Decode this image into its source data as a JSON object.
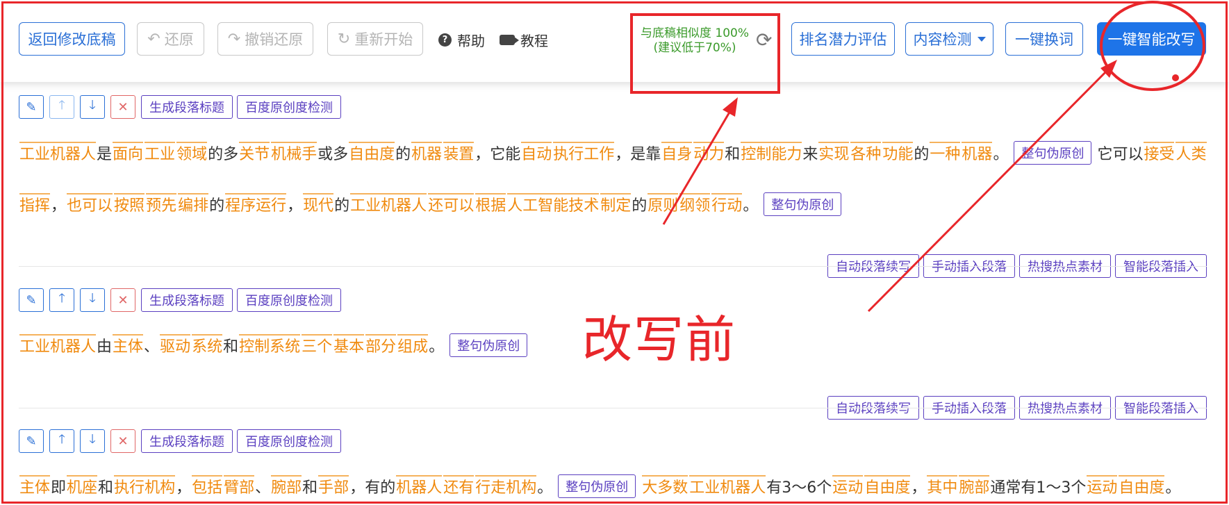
{
  "toolbar": {
    "back_label": "返回修改底稿",
    "undo_label": "还原",
    "redo_label": "撤销还原",
    "restart_label": "重新开始",
    "help_label": "帮助",
    "tutorial_label": "教程",
    "similarity_line1": "与底稿相似度 100%",
    "similarity_line2": "(建议低于70%)",
    "rank_label": "排名潜力评估",
    "content_check_label": "内容检测",
    "swap_words_label": "一键换词",
    "smart_rewrite_label": "一键智能改写"
  },
  "paragraph_controls": {
    "gen_title_label": "生成段落标题",
    "baidu_check_label": "百度原创度检测",
    "delete_symbol": "✕"
  },
  "rewrite_sentence_label": "整句伪原创",
  "actions": {
    "auto_continue": "自动段落续写",
    "manual_insert": "手动插入段落",
    "hot_material": "热搜热点素材",
    "smart_insert": "智能段落插入"
  },
  "paragraphs": [
    {
      "line1": [
        {
          "t": "工业机器人",
          "k": 1
        },
        {
          "t": "是",
          "k": 0
        },
        {
          "t": "面向",
          "k": 1
        },
        {
          "t": "工业",
          "k": 1
        },
        {
          "t": "领域",
          "k": 1
        },
        {
          "t": "的多",
          "k": 0
        },
        {
          "t": "关节",
          "k": 1
        },
        {
          "t": "机械手",
          "k": 1
        },
        {
          "t": "或多",
          "k": 0
        },
        {
          "t": "自由度",
          "k": 1
        },
        {
          "t": "的",
          "k": 0
        },
        {
          "t": "机器",
          "k": 1
        },
        {
          "t": "装置",
          "k": 1
        },
        {
          "t": "，它能",
          "k": 0
        },
        {
          "t": "自动",
          "k": 1
        },
        {
          "t": "执行工作",
          "k": 1
        },
        {
          "t": "，是靠",
          "k": 0
        },
        {
          "t": "自身",
          "k": 1
        },
        {
          "t": "动力",
          "k": 1
        },
        {
          "t": "和",
          "k": 0
        },
        {
          "t": "控制能力",
          "k": 1
        },
        {
          "t": "来",
          "k": 0
        },
        {
          "t": "实现",
          "k": 1
        },
        {
          "t": "各种",
          "k": 1
        },
        {
          "t": "功能",
          "k": 1
        },
        {
          "t": "的",
          "k": 0
        },
        {
          "t": "一种",
          "k": 1
        },
        {
          "t": "机器",
          "k": 1
        },
        {
          "t": "。",
          "k": 0
        }
      ],
      "line1_tail": [
        {
          "t": "它可以",
          "k": 0
        },
        {
          "t": "接受",
          "k": 1
        },
        {
          "t": "人类",
          "k": 1
        }
      ],
      "line2": [
        {
          "t": "指挥",
          "k": 1
        },
        {
          "t": "，",
          "k": 0
        },
        {
          "t": "也可以",
          "k": 1
        },
        {
          "t": "按照",
          "k": 1
        },
        {
          "t": "预先",
          "k": 1
        },
        {
          "t": "编排",
          "k": 1
        },
        {
          "t": "的",
          "k": 0
        },
        {
          "t": "程序运行",
          "k": 1
        },
        {
          "t": "，",
          "k": 0
        },
        {
          "t": "现代",
          "k": 1
        },
        {
          "t": "的",
          "k": 0
        },
        {
          "t": "工业机器人",
          "k": 1
        },
        {
          "t": "还可以",
          "k": 1
        },
        {
          "t": "根据",
          "k": 1
        },
        {
          "t": "人工智能技术",
          "k": 1
        },
        {
          "t": "制定",
          "k": 1
        },
        {
          "t": "的",
          "k": 0
        },
        {
          "t": "原则",
          "k": 1
        },
        {
          "t": "纲领",
          "k": 1
        },
        {
          "t": "行动",
          "k": 1
        },
        {
          "t": "。",
          "k": 0
        }
      ]
    },
    {
      "line1": [
        {
          "t": "工业机器人",
          "k": 1
        },
        {
          "t": "由",
          "k": 0
        },
        {
          "t": "主体",
          "k": 1
        },
        {
          "t": "、",
          "k": 0
        },
        {
          "t": "驱动",
          "k": 1
        },
        {
          "t": "系统",
          "k": 1
        },
        {
          "t": "和",
          "k": 0
        },
        {
          "t": "控制系统",
          "k": 1
        },
        {
          "t": "三个",
          "k": 1
        },
        {
          "t": "基本",
          "k": 1
        },
        {
          "t": "部分",
          "k": 1
        },
        {
          "t": "组成",
          "k": 1
        },
        {
          "t": "。",
          "k": 0
        }
      ]
    },
    {
      "line1": [
        {
          "t": "主体",
          "k": 1
        },
        {
          "t": "即",
          "k": 0
        },
        {
          "t": "机座",
          "k": 1
        },
        {
          "t": "和",
          "k": 0
        },
        {
          "t": "执行机构",
          "k": 1
        },
        {
          "t": "，",
          "k": 0
        },
        {
          "t": "包括",
          "k": 1
        },
        {
          "t": "臂部",
          "k": 1
        },
        {
          "t": "、",
          "k": 0
        },
        {
          "t": "腕部",
          "k": 1
        },
        {
          "t": "和",
          "k": 0
        },
        {
          "t": "手部",
          "k": 1
        },
        {
          "t": "，有的",
          "k": 0
        },
        {
          "t": "机器人",
          "k": 1
        },
        {
          "t": "还有",
          "k": 1
        },
        {
          "t": "行走机构",
          "k": 1
        },
        {
          "t": "。",
          "k": 0
        }
      ],
      "line1_tail": [
        {
          "t": "大多数",
          "k": 1
        },
        {
          "t": "工业机器人",
          "k": 1
        },
        {
          "t": "有3～6个",
          "k": 0
        },
        {
          "t": "运动",
          "k": 1
        },
        {
          "t": "自由度",
          "k": 1
        },
        {
          "t": "，",
          "k": 0
        },
        {
          "t": "其中",
          "k": 1
        },
        {
          "t": "腕部",
          "k": 1
        },
        {
          "t": "通常有1～3个",
          "k": 0
        },
        {
          "t": "运动",
          "k": 1
        },
        {
          "t": "自由度",
          "k": 1
        },
        {
          "t": "。",
          "k": 0
        }
      ]
    }
  ],
  "annotation_label": "改写前",
  "colors": {
    "accent_blue": "#2a6fd6",
    "keyword_orange": "#f08a0e",
    "tag_purple": "#5a3fc0",
    "annotation_red": "#e8262a",
    "similarity_green": "#3a9a2a"
  }
}
